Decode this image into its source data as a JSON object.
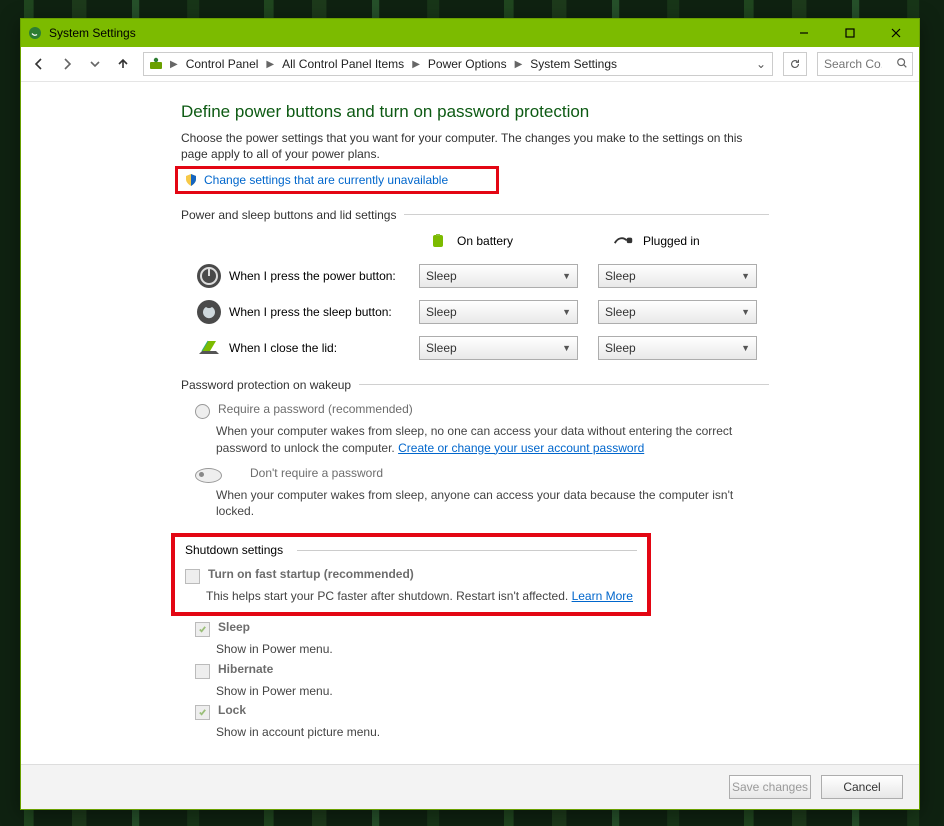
{
  "window": {
    "title": "System Settings"
  },
  "breadcrumb": {
    "items": [
      "Control Panel",
      "All Control Panel Items",
      "Power Options",
      "System Settings"
    ]
  },
  "search": {
    "placeholder": "Search Co..."
  },
  "page": {
    "heading": "Define power buttons and turn on password protection",
    "desc": "Choose the power settings that you want for your computer. The changes you make to the settings on this page apply to all of your power plans.",
    "change_link": "Change settings that are currently unavailable",
    "section_power": "Power and sleep buttons and lid settings",
    "col_battery": "On battery",
    "col_plugged": "Plugged in",
    "rows": {
      "power": {
        "label": "When I press the power button:",
        "bat": "Sleep",
        "plug": "Sleep"
      },
      "sleep": {
        "label": "When I press the sleep button:",
        "bat": "Sleep",
        "plug": "Sleep"
      },
      "lid": {
        "label": "When I close the lid:",
        "bat": "Sleep",
        "plug": "Sleep"
      }
    },
    "section_pwd": "Password protection on wakeup",
    "pwd_req": {
      "title": "Require a password (recommended)",
      "desc1": "When your computer wakes from sleep, no one can access your data without entering the correct password to unlock the computer. ",
      "link": "Create or change your user account password"
    },
    "pwd_noreq": {
      "title": "Don't require a password",
      "desc": "When your computer wakes from sleep, anyone can access your data because the computer isn't locked."
    },
    "section_shutdown": "Shutdown settings",
    "fast": {
      "title": "Turn on fast startup (recommended)",
      "desc": "This helps start your PC faster after shutdown. Restart isn't affected. ",
      "link": "Learn More"
    },
    "sleep_item": {
      "title": "Sleep",
      "desc": "Show in Power menu."
    },
    "hib_item": {
      "title": "Hibernate",
      "desc": "Show in Power menu."
    },
    "lock_item": {
      "title": "Lock",
      "desc": "Show in account picture menu."
    }
  },
  "footer": {
    "save": "Save changes",
    "cancel": "Cancel"
  }
}
